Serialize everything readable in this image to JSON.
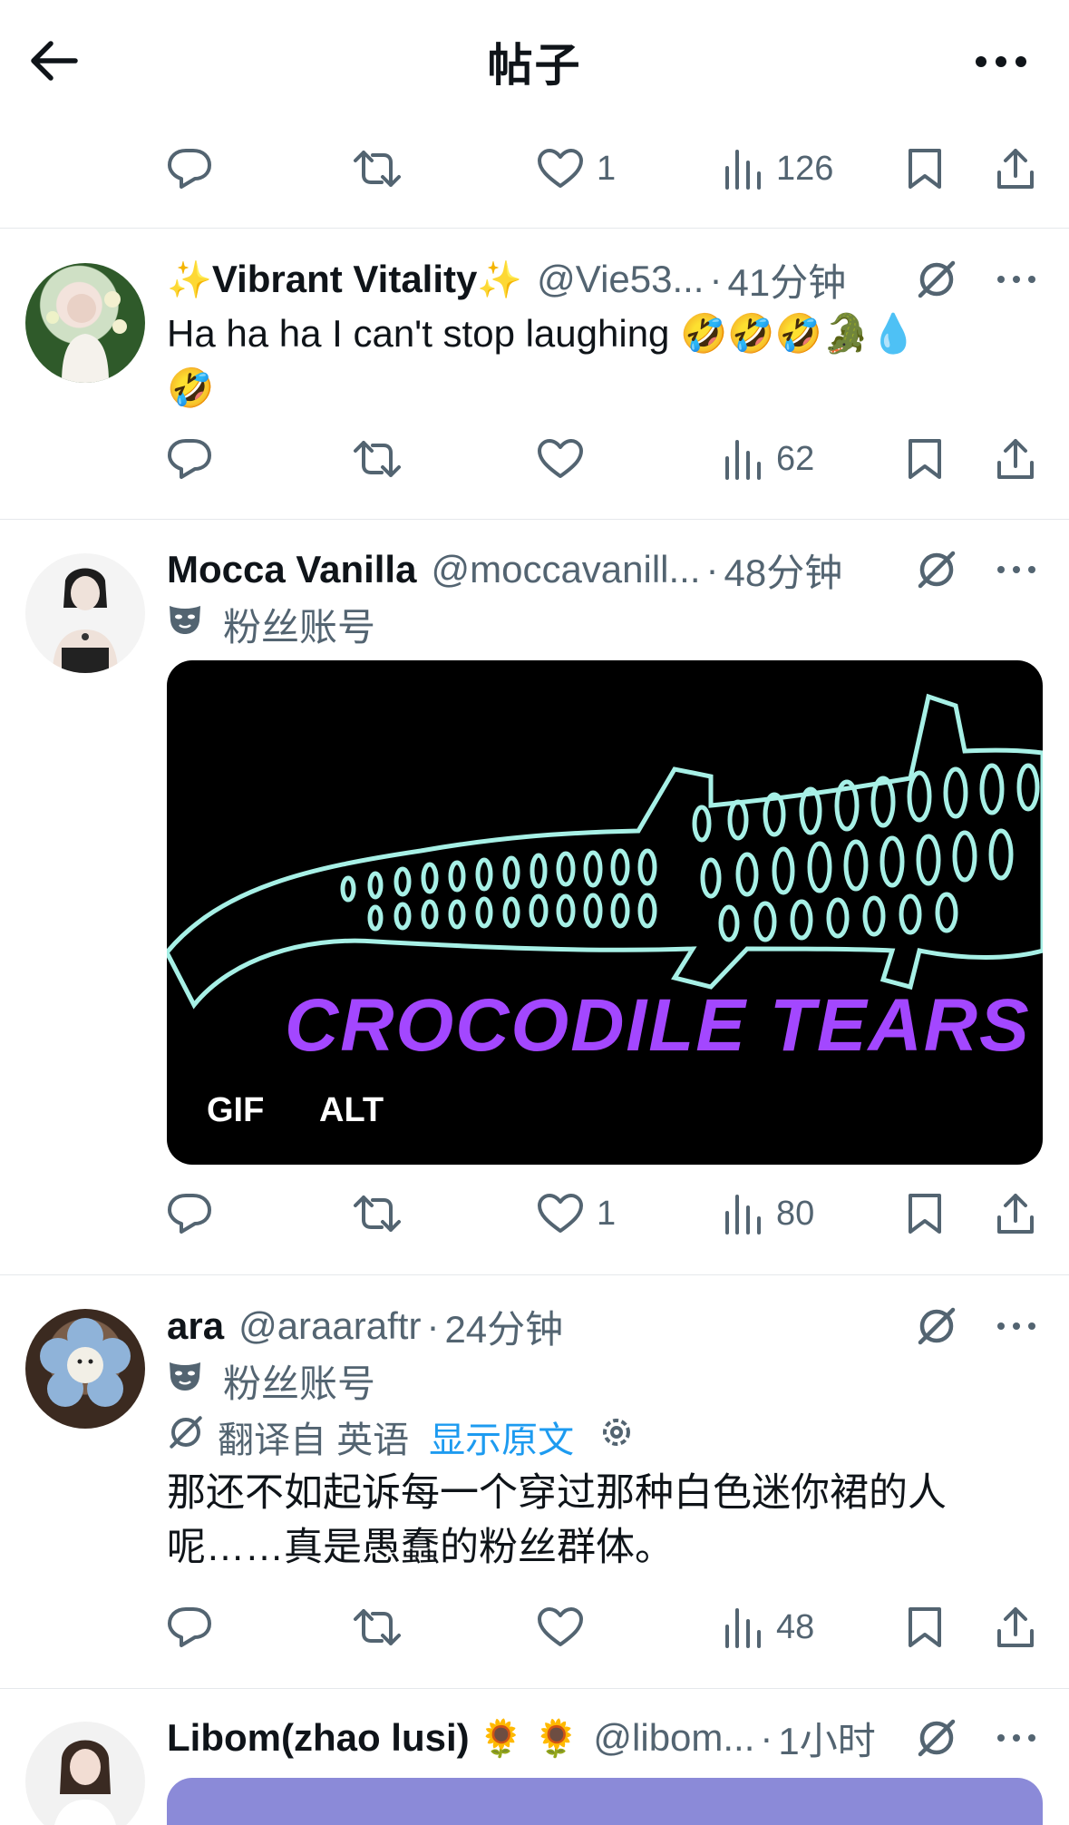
{
  "header": {
    "title": "帖子"
  },
  "colors": {
    "link": "#1d9bf0",
    "muted": "#536471",
    "text": "#0f1419",
    "gif_text": "#a347ff",
    "gif_croc": "#a7f0e6"
  },
  "first_actions": {
    "likes": "1",
    "views": "126"
  },
  "posts": [
    {
      "name": "Vibrant Vitality",
      "name_decor": "✨",
      "handle": "@Vie53...",
      "dot": "·",
      "time": "41分钟",
      "text_line1": "Ha ha ha I can't stop laughing 🤣🤣🤣🐊💧",
      "text_line2": "🤣",
      "likes": "",
      "views": "62"
    },
    {
      "name": "Mocca Vanilla",
      "handle": "@moccavanill...",
      "dot": "·",
      "time": "48分钟",
      "badge": "粉丝账号",
      "gif_caption": "CROCODILE TEARS",
      "gif_label": "GIF",
      "alt_label": "ALT",
      "likes": "1",
      "views": "80"
    },
    {
      "name": "ara",
      "handle": "@araaraftr",
      "dot": "·",
      "time": "24分钟",
      "badge": "粉丝账号",
      "translated_from": "翻译自 英语",
      "show_original": "显示原文",
      "text_line1": "那还不如起诉每一个穿过那种白色迷你裙的人",
      "text_line2": "呢……真是愚蠢的粉丝群体。",
      "likes": "",
      "views": "48"
    },
    {
      "name": "Libom(zhao lusi)",
      "name_decor": "🌻 🌻",
      "handle": "@libom...",
      "dot": "·",
      "time": "1小时"
    }
  ]
}
